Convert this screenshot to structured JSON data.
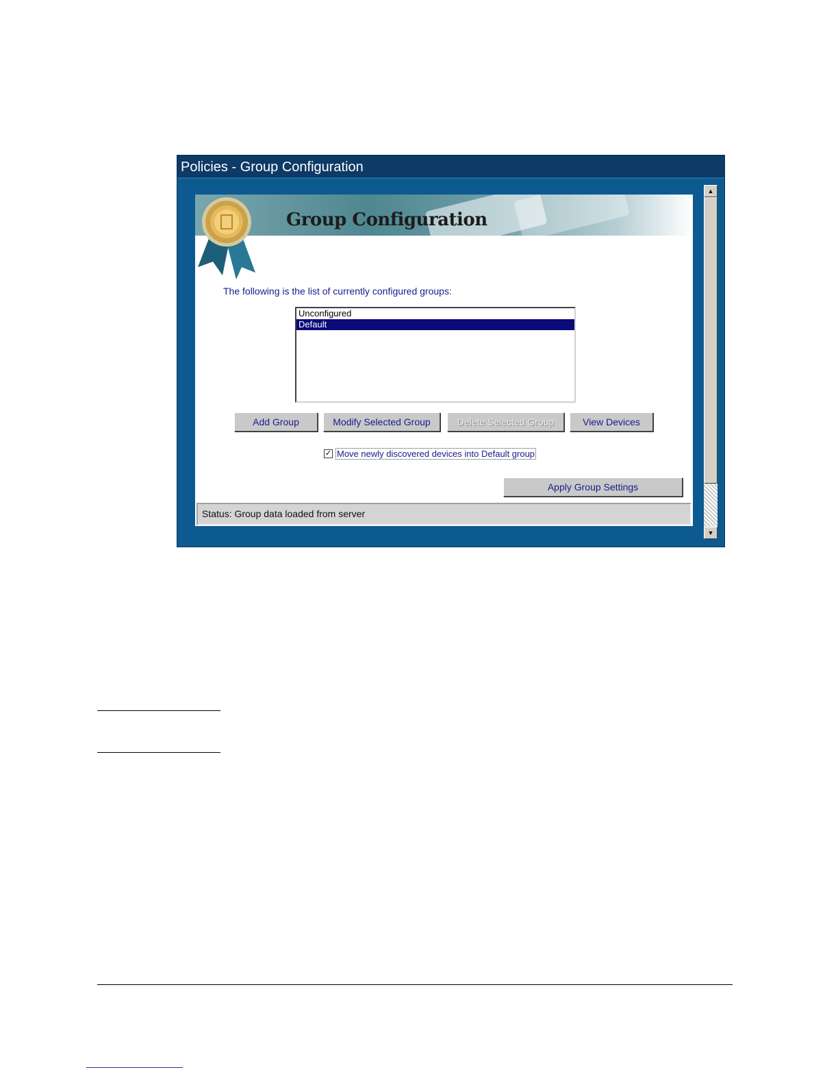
{
  "window": {
    "title": "Policies - Group Configuration"
  },
  "banner": {
    "title": "Group Configuration"
  },
  "intro_text": "The following is the list of currently configured groups:",
  "groups": {
    "items": [
      "Unconfigured",
      "Default"
    ],
    "selected": "Default"
  },
  "buttons": {
    "add_group": "Add Group",
    "modify_selected_group": "Modify Selected Group",
    "delete_selected_group": "Delete Selected Group",
    "view_devices": "View Devices",
    "apply_group_settings": "Apply Group Settings"
  },
  "checkbox": {
    "label": "Move newly discovered devices into Default group",
    "checked": true
  },
  "status": {
    "text": "Status:  Group data loaded from server"
  },
  "colors": {
    "window_frame": "#0d5a90",
    "title_bar": "#0d3a66",
    "selection": "#0a0a7a",
    "label_text": "#1a1a8c"
  }
}
